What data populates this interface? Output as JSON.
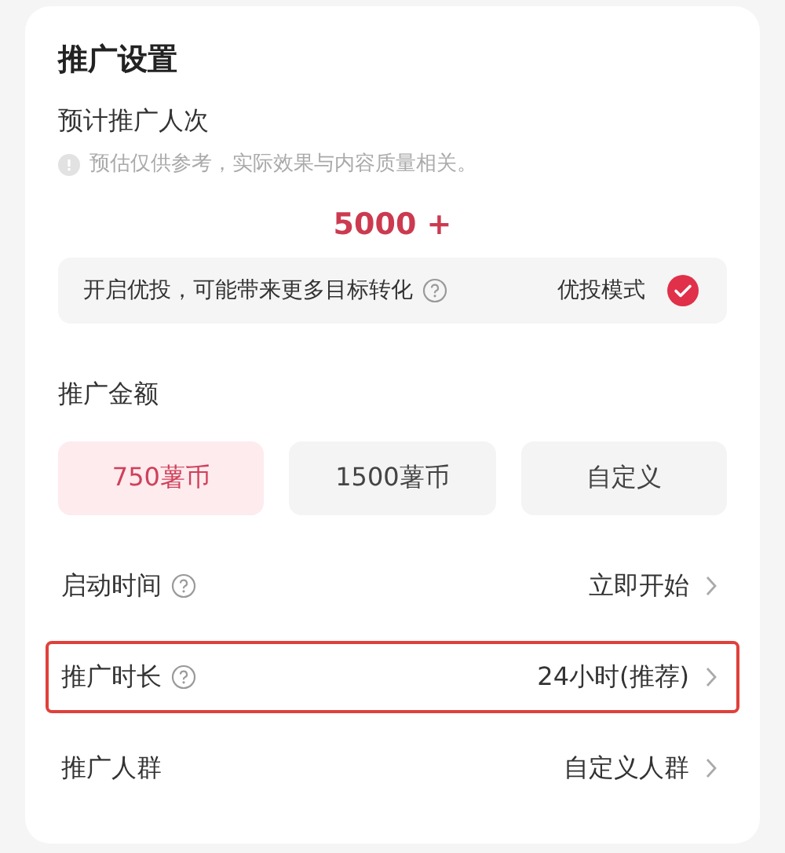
{
  "title": "推广设置",
  "estimate": {
    "label": "预计推广人次",
    "note": "预估仅供参考，实际效果与内容质量相关。",
    "value": "5000 +"
  },
  "boost": {
    "text": "开启优投，可能带来更多目标转化",
    "help": true,
    "mode_label": "优投模式",
    "checked": true
  },
  "amount": {
    "label": "推广金额",
    "options": [
      {
        "label": "750薯币",
        "selected": true
      },
      {
        "label": "1500薯币",
        "selected": false
      },
      {
        "label": "自定义",
        "selected": false
      }
    ]
  },
  "rows": [
    {
      "label": "启动时间",
      "help": true,
      "value": "立即开始",
      "highlighted": false
    },
    {
      "label": "推广时长",
      "help": true,
      "value": "24小时(推荐)",
      "highlighted": true
    },
    {
      "label": "推广人群",
      "help": false,
      "value": "自定义人群",
      "highlighted": false
    }
  ]
}
